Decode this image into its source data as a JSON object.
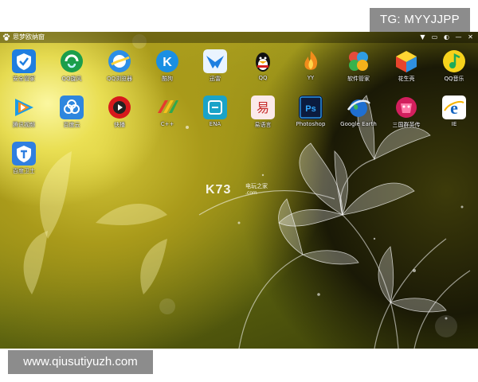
{
  "overlay": {
    "tg_label": "TG: MYYJJPP",
    "url_label": "www.qiusutiyuzh.com"
  },
  "window": {
    "title": "思梦欧纳窗",
    "logo_icon": "paw-icon",
    "controls": [
      "menu-icon",
      "window-icon",
      "settings-icon",
      "minimize-icon",
      "close-icon"
    ],
    "control_glyphs": [
      "▼",
      "▭",
      "◐",
      "—",
      "✕"
    ]
  },
  "watermark": {
    "text": "K73",
    "subtext": "电玩之家",
    "domain": ".com"
  },
  "desktop_icons": [
    {
      "label": "安全管家",
      "icon": "tencent-security-icon"
    },
    {
      "label": "QQ旋风",
      "icon": "qq-whirlwind-icon"
    },
    {
      "label": "QQ浏览器",
      "icon": "qq-browser-icon"
    },
    {
      "label": "酷狗",
      "icon": "kugou-icon"
    },
    {
      "label": "迅雷",
      "icon": "xunlei-icon"
    },
    {
      "label": "QQ",
      "icon": "qq-penguin-icon"
    },
    {
      "label": "YY",
      "icon": "yy-flame-icon"
    },
    {
      "label": "软件管家",
      "icon": "software-manager-icon"
    },
    {
      "label": "花生壳",
      "icon": "peanut-shell-icon"
    },
    {
      "label": "QQ音乐",
      "icon": "qq-music-icon"
    },
    {
      "label": "腾讯视频",
      "icon": "tencent-video-icon"
    },
    {
      "label": "百度云",
      "icon": "baidu-cloud-icon"
    },
    {
      "label": "快播",
      "icon": "qvod-icon"
    },
    {
      "label": "C++",
      "icon": "cpp-icon"
    },
    {
      "label": "ENA",
      "icon": "ena-icon"
    },
    {
      "label": "易语言",
      "icon": "eyuyan-icon"
    },
    {
      "label": "Photoshop",
      "icon": "photoshop-icon"
    },
    {
      "label": "Google Earth",
      "icon": "google-earth-icon"
    },
    {
      "label": "三国群英传",
      "icon": "game-hero-icon"
    },
    {
      "label": "IE",
      "icon": "internet-explorer-icon"
    },
    {
      "label": "百度卫士",
      "icon": "baidu-guard-icon"
    }
  ]
}
